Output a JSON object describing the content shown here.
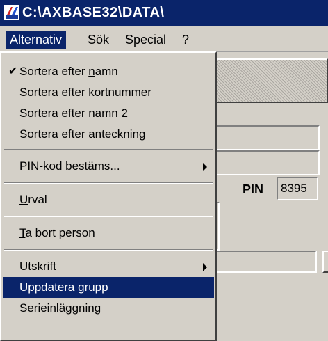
{
  "window": {
    "title": "C:\\AXBASE32\\DATA\\"
  },
  "menubar": {
    "items": [
      {
        "id": "alternativ",
        "pre": "",
        "acc": "A",
        "post": "lternativ"
      },
      {
        "id": "sok",
        "pre": "",
        "acc": "S",
        "post": "ök"
      },
      {
        "id": "special",
        "pre": "",
        "acc": "S",
        "post": "pecial"
      },
      {
        "id": "help",
        "pre": "",
        "acc": "",
        "post": "?"
      }
    ]
  },
  "menu": {
    "items": [
      {
        "pre": "Sortera efter ",
        "acc": "n",
        "post": "amn",
        "checked": true
      },
      {
        "pre": "Sortera efter ",
        "acc": "k",
        "post": "ortnummer"
      },
      {
        "pre": "Sortera efter namn 2",
        "acc": "",
        "post": ""
      },
      {
        "pre": "Sortera efter anteckning",
        "acc": "",
        "post": ""
      },
      {
        "pre": "PIN-kod bestäms...",
        "acc": "",
        "post": "",
        "submenu": true
      },
      {
        "pre": "",
        "acc": "U",
        "post": "rval"
      },
      {
        "pre": "",
        "acc": "T",
        "post": "a bort person"
      },
      {
        "pre": "",
        "acc": "U",
        "post": "tskrift",
        "submenu": true
      },
      {
        "pre": "Uppdatera grupp",
        "acc": "",
        "post": "",
        "selected": true
      },
      {
        "pre": "Serieinläggning",
        "acc": "",
        "post": ""
      }
    ]
  },
  "form": {
    "pin_label": "PIN",
    "pin_value": "8395"
  },
  "colors": {
    "titlebar": "#0a246a",
    "face": "#d4d0c8",
    "highlight": "#0a246a"
  },
  "icons": {
    "checkmark": "check-icon",
    "submenu": "submenu-arrow-icon",
    "app": "app-icon"
  }
}
